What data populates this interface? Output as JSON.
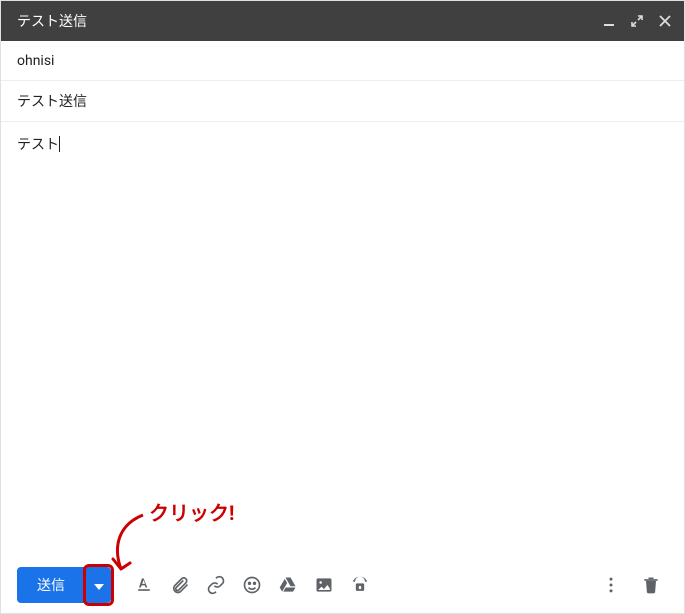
{
  "header": {
    "title": "テスト送信"
  },
  "fields": {
    "to": "ohnisi",
    "subject": "テスト送信"
  },
  "body": {
    "text": "テスト"
  },
  "toolbar": {
    "send_label": "送信"
  },
  "annotation": {
    "text": "クリック!"
  },
  "colors": {
    "accent": "#1a73e8",
    "annotation": "#c00",
    "header_bg": "#404040",
    "icon": "#5f6368"
  }
}
